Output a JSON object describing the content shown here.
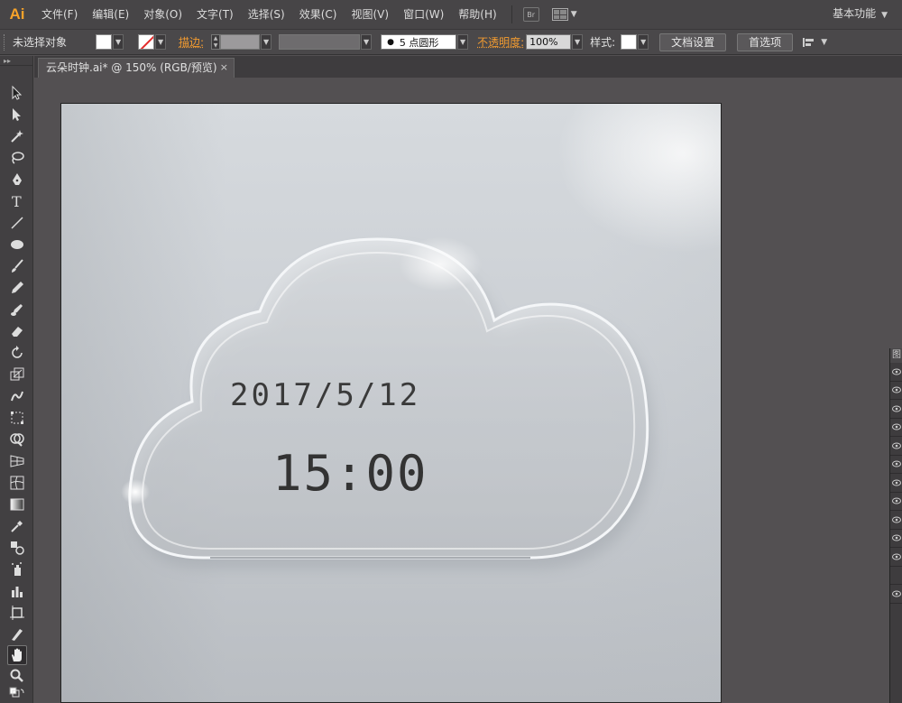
{
  "app": {
    "logo": "Ai"
  },
  "menu": {
    "items": [
      "文件(F)",
      "编辑(E)",
      "对象(O)",
      "文字(T)",
      "选择(S)",
      "效果(C)",
      "视图(V)",
      "窗口(W)",
      "帮助(H)"
    ],
    "bridge_label": "Br",
    "workspace": "基本功能"
  },
  "control": {
    "selection_status": "未选择对象",
    "stroke_label": "描边:",
    "brush": "5 点圆形",
    "opacity_label": "不透明度:",
    "opacity_value": "100%",
    "style_label": "样式:",
    "doc_setup_button": "文档设置",
    "preferences_button": "首选项"
  },
  "document": {
    "tab_title": "云朵时钟.ai* @ 150% (RGB/预览)",
    "close_glyph": "×"
  },
  "artwork": {
    "date": "2017/5/12",
    "time": "15:00"
  },
  "panel": {
    "header": "图"
  },
  "colors": {
    "accent_orange": "#f29b30",
    "logo_orange": "#f6a22a",
    "none_red": "#e32b2b"
  },
  "tools": [
    "selection-tool",
    "direct-selection-tool",
    "magic-wand-tool",
    "lasso-tool",
    "pen-tool",
    "type-tool",
    "line-tool",
    "ellipse-tool",
    "paintbrush-tool",
    "pencil-tool",
    "blob-brush-tool",
    "eraser-tool",
    "rotate-tool",
    "scale-tool",
    "warp-tool",
    "free-transform-tool",
    "shape-builder-tool",
    "perspective-grid-tool",
    "mesh-tool",
    "gradient-tool",
    "eyedropper-tool",
    "blend-tool",
    "symbol-sprayer-tool",
    "column-graph-tool",
    "artboard-tool",
    "slice-tool",
    "hand-tool",
    "zoom-tool"
  ]
}
